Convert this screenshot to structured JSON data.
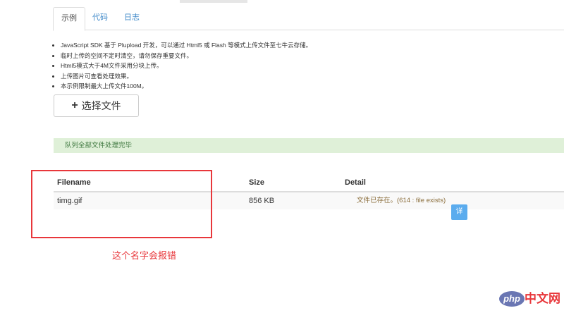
{
  "tabs": [
    "示例",
    "代码",
    "日志"
  ],
  "notes": [
    "JavaScript SDK 基于 Plupload 开发，可以通过 Html5 或 Flash 等模式上传文件至七牛云存储。",
    "临时上传的空间不定时清空，请勿保存重要文件。",
    "Html5模式大于4M文件采用分块上传。",
    "上传图片可查看处理效果。",
    "本示例限制最大上传文件100M。"
  ],
  "pick_button": {
    "icon": "plus-icon",
    "label": "选择文件"
  },
  "alert": "队列全部文件处理完毕",
  "table": {
    "headers": [
      "Filename",
      "Size",
      "Detail"
    ],
    "rows": [
      {
        "filename": "timg.gif",
        "size": "856 KB",
        "detail": "文件已存在。(614 : file exists)",
        "action": "详"
      }
    ]
  },
  "annotation": "这个名字会报错",
  "watermark": {
    "logo": "php",
    "text": "中文网"
  }
}
